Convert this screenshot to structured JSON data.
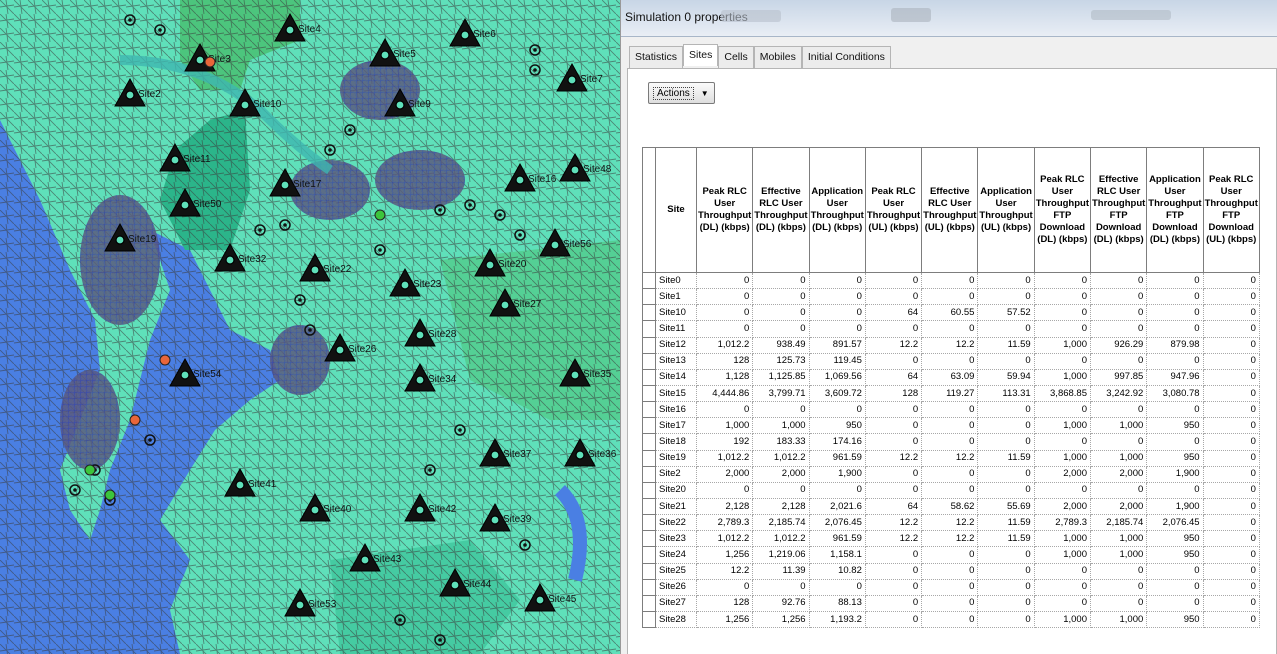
{
  "window": {
    "title": "Simulation 0 properties"
  },
  "tabs": [
    {
      "label": "Statistics",
      "active": false
    },
    {
      "label": "Sites",
      "active": true
    },
    {
      "label": "Cells",
      "active": false
    },
    {
      "label": "Mobiles",
      "active": false
    },
    {
      "label": "Initial Conditions",
      "active": false
    }
  ],
  "actions": {
    "label": "Actions"
  },
  "table": {
    "headers": [
      "Site",
      "Peak RLC User Throughput (DL) (kbps)",
      "Effective RLC User Throughput (DL) (kbps)",
      "Application User Throughput (DL) (kbps)",
      "Peak RLC User Throughput (UL) (kbps)",
      "Effective RLC User Throughput (UL) (kbps)",
      "Application User Throughput (UL) (kbps)",
      "Peak RLC User Throughput FTP Download (DL) (kbps)",
      "Effective RLC User Throughput FTP Download (DL) (kbps)",
      "Application User Throughput FTP Download (DL) (kbps)",
      "Peak RLC User Throughput FTP Download (UL) (kbps)"
    ],
    "rows": [
      [
        "Site0",
        "0",
        "0",
        "0",
        "0",
        "0",
        "0",
        "0",
        "0",
        "0",
        "0"
      ],
      [
        "Site1",
        "0",
        "0",
        "0",
        "0",
        "0",
        "0",
        "0",
        "0",
        "0",
        "0"
      ],
      [
        "Site10",
        "0",
        "0",
        "0",
        "64",
        "60.55",
        "57.52",
        "0",
        "0",
        "0",
        "0"
      ],
      [
        "Site11",
        "0",
        "0",
        "0",
        "0",
        "0",
        "0",
        "0",
        "0",
        "0",
        "0"
      ],
      [
        "Site12",
        "1,012.2",
        "938.49",
        "891.57",
        "12.2",
        "12.2",
        "11.59",
        "1,000",
        "926.29",
        "879.98",
        "0"
      ],
      [
        "Site13",
        "128",
        "125.73",
        "119.45",
        "0",
        "0",
        "0",
        "0",
        "0",
        "0",
        "0"
      ],
      [
        "Site14",
        "1,128",
        "1,125.85",
        "1,069.56",
        "64",
        "63.09",
        "59.94",
        "1,000",
        "997.85",
        "947.96",
        "0"
      ],
      [
        "Site15",
        "4,444.86",
        "3,799.71",
        "3,609.72",
        "128",
        "119.27",
        "113.31",
        "3,868.85",
        "3,242.92",
        "3,080.78",
        "0"
      ],
      [
        "Site16",
        "0",
        "0",
        "0",
        "0",
        "0",
        "0",
        "0",
        "0",
        "0",
        "0"
      ],
      [
        "Site17",
        "1,000",
        "1,000",
        "950",
        "0",
        "0",
        "0",
        "1,000",
        "1,000",
        "950",
        "0"
      ],
      [
        "Site18",
        "192",
        "183.33",
        "174.16",
        "0",
        "0",
        "0",
        "0",
        "0",
        "0",
        "0"
      ],
      [
        "Site19",
        "1,012.2",
        "1,012.2",
        "961.59",
        "12.2",
        "12.2",
        "11.59",
        "1,000",
        "1,000",
        "950",
        "0"
      ],
      [
        "Site2",
        "2,000",
        "2,000",
        "1,900",
        "0",
        "0",
        "0",
        "2,000",
        "2,000",
        "1,900",
        "0"
      ],
      [
        "Site20",
        "0",
        "0",
        "0",
        "0",
        "0",
        "0",
        "0",
        "0",
        "0",
        "0"
      ],
      [
        "Site21",
        "2,128",
        "2,128",
        "2,021.6",
        "64",
        "58.62",
        "55.69",
        "2,000",
        "2,000",
        "1,900",
        "0"
      ],
      [
        "Site22",
        "2,789.3",
        "2,185.74",
        "2,076.45",
        "12.2",
        "12.2",
        "11.59",
        "2,789.3",
        "2,185.74",
        "2,076.45",
        "0"
      ],
      [
        "Site23",
        "1,012.2",
        "1,012.2",
        "961.59",
        "12.2",
        "12.2",
        "11.59",
        "1,000",
        "1,000",
        "950",
        "0"
      ],
      [
        "Site24",
        "1,256",
        "1,219.06",
        "1,158.1",
        "0",
        "0",
        "0",
        "1,000",
        "1,000",
        "950",
        "0"
      ],
      [
        "Site25",
        "12.2",
        "11.39",
        "10.82",
        "0",
        "0",
        "0",
        "0",
        "0",
        "0",
        "0"
      ],
      [
        "Site26",
        "0",
        "0",
        "0",
        "0",
        "0",
        "0",
        "0",
        "0",
        "0",
        "0"
      ],
      [
        "Site27",
        "128",
        "92.76",
        "88.13",
        "0",
        "0",
        "0",
        "0",
        "0",
        "0",
        "0"
      ],
      [
        "Site28",
        "1,256",
        "1,256",
        "1,193.2",
        "0",
        "0",
        "0",
        "1,000",
        "1,000",
        "950",
        "0"
      ]
    ]
  },
  "map": {
    "colors": {
      "sea": "#4a7fe3",
      "land": "#5fe0ba",
      "land_dark": "#2bb58a",
      "forest": "#4cc57d",
      "urban": "#58587a",
      "road": "#3b3b3b"
    },
    "sites": [
      {
        "label": "Site4"
      },
      {
        "label": "Site3"
      },
      {
        "label": "Site5"
      },
      {
        "label": "Site6"
      },
      {
        "label": "Site7"
      },
      {
        "label": "Site2"
      },
      {
        "label": "Site10"
      },
      {
        "label": "Site9"
      },
      {
        "label": "Site11"
      },
      {
        "label": "Site50"
      },
      {
        "label": "Site17"
      },
      {
        "label": "Site16"
      },
      {
        "label": "Site48"
      },
      {
        "label": "Site19"
      },
      {
        "label": "Site32"
      },
      {
        "label": "Site22"
      },
      {
        "label": "Site20"
      },
      {
        "label": "Site23"
      },
      {
        "label": "Site56"
      },
      {
        "label": "Site27"
      },
      {
        "label": "Site28"
      },
      {
        "label": "Site26"
      },
      {
        "label": "Site34"
      },
      {
        "label": "Site35"
      },
      {
        "label": "Site54"
      },
      {
        "label": "Site37"
      },
      {
        "label": "Site36"
      },
      {
        "label": "Site41"
      },
      {
        "label": "Site40"
      },
      {
        "label": "Site39"
      },
      {
        "label": "Site42"
      },
      {
        "label": "Site43"
      },
      {
        "label": "Site44"
      },
      {
        "label": "Site45"
      },
      {
        "label": "Site53"
      }
    ]
  }
}
